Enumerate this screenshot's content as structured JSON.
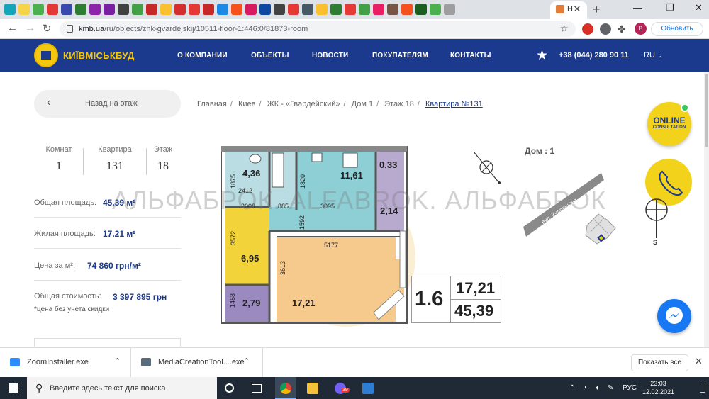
{
  "browser": {
    "active_tab_title": "Н",
    "url_host": "kmb.ua",
    "url_path": "/ru/objects/zhk-gvardejskij/10511-floor-1:446:0/81873-room",
    "refresh_button": "Обновить",
    "profile_initial": "B",
    "favicon_colors": [
      "#15a4b8",
      "#f5d547",
      "#4caf50",
      "#e53935",
      "#3949ab",
      "#2e7d32",
      "#8e24aa",
      "#7b1fa2",
      "#424242",
      "#43a047",
      "#c62828",
      "#fbc02d",
      "#d32f2f",
      "#e53935",
      "#c62828",
      "#1e88e5",
      "#f4511e",
      "#d81b60",
      "#0d47a1",
      "#424242",
      "#e53935",
      "#455a64",
      "#fbc02d",
      "#2e7d32",
      "#e53935",
      "#43a047",
      "#e91e63",
      "#795548",
      "#f4511e",
      "#1b5e20",
      "#4caf50",
      "#9e9e9e"
    ]
  },
  "header": {
    "logo_text": "КИЇВМІСЬКБУД",
    "menu": [
      "О КОМПАНИИ",
      "ОБЪЕКТЫ",
      "НОВОСТИ",
      "ПОКУПАТЕЛЯМ",
      "КОНТАКТЫ"
    ],
    "phone": "+38 (044) 280 90 11",
    "lang": "RU"
  },
  "back_button": "Назад на этаж",
  "breadcrumb": [
    "Главная",
    "Киев",
    "ЖК - «Гвардейский»",
    "Дом 1",
    "Этаж 18",
    "Квартира №131"
  ],
  "stats": [
    {
      "label": "Комнат",
      "value": "1"
    },
    {
      "label": "Квартира",
      "value": "131"
    },
    {
      "label": "Этаж",
      "value": "18"
    }
  ],
  "info": {
    "total_area_label": "Общая площадь:",
    "total_area_value": "45.39 м²",
    "living_area_label": "Жилая площадь:",
    "living_area_value": "17.21 м²",
    "price_m2_label": "Цена за м²:",
    "price_m2_value": "74 860 грн/м²",
    "total_price_label": "Общая стоимость:",
    "total_price_value": "3 397 895 грн",
    "note": "*цена без учета скидки"
  },
  "plan": {
    "rooms": [
      {
        "label": "4,36",
        "color": "#b9dde2"
      },
      {
        "label": "11,61",
        "color": "#8ecfd6"
      },
      {
        "label": "0,33",
        "color": "#b8a9cf"
      },
      {
        "label": "2,14",
        "color": "#b8a9cf"
      },
      {
        "label": "6,95",
        "color": "#f3d33a"
      },
      {
        "label": "2,79",
        "color": "#9a8ac0"
      },
      {
        "label": "17,21",
        "color": "#f6c98c"
      }
    ],
    "dimensions": [
      "1875",
      "1820",
      "2412",
      "2008",
      "885",
      "1592",
      "3095",
      "3572",
      "5177",
      "3613",
      "1458"
    ]
  },
  "summary_table": {
    "big": "1.6",
    "living": "17,21",
    "total": "45,39"
  },
  "house_label": "Дом : 1",
  "street_name": "вул. Кудряшова",
  "watermark": "АЛЬФАБРОК. ALFABROK. АЛЬФАБРОК",
  "online_widget": {
    "line1": "ONLINE",
    "line2": "CONSULTATION"
  },
  "downloads": [
    {
      "name": "ZoomInstaller.exe",
      "icon_color": "#2d8cff"
    },
    {
      "name": "MediaCreationTool....exe",
      "icon_color": "#5b6b7b"
    }
  ],
  "show_all": "Показать все",
  "taskbar": {
    "search_placeholder": "Введите здесь текст для поиска",
    "lang": "РУС",
    "time": "23:03",
    "date": "12.02.2021",
    "badge": "39"
  }
}
